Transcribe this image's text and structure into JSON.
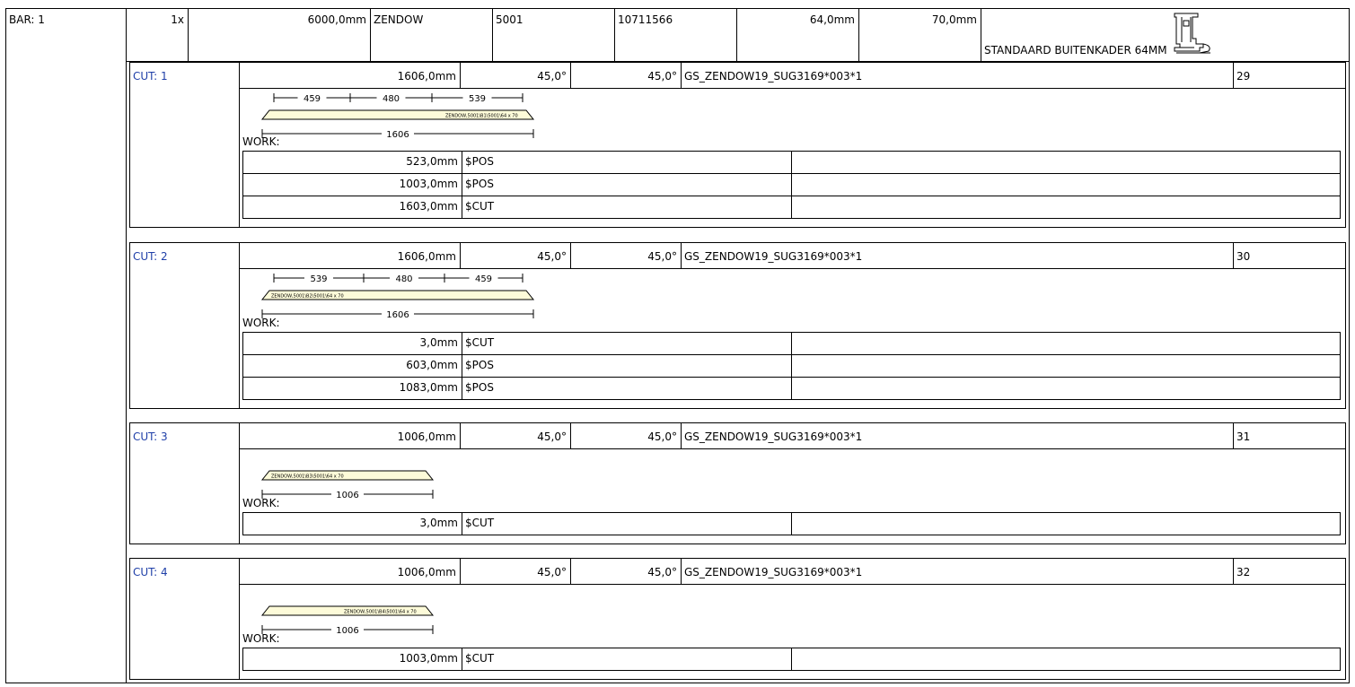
{
  "bar": {
    "label": "BAR: 1",
    "qty": "1x",
    "length": "6000,0mm",
    "brand": "ZENDOW",
    "color_code": "5001",
    "article": "10711566",
    "width": "64,0mm",
    "height": "70,0mm",
    "description": "STANDAARD BUITENKADER 64MM",
    "profile_icon": "profile-section-icon"
  },
  "cuts": [
    {
      "label": "CUT: 1",
      "length": "1606,0mm",
      "angle_left": "45,0°",
      "angle_right": "45,0°",
      "reference": "GS_ZENDOW19_SUG3169*003*1",
      "number": "29",
      "dims": [
        "459",
        "480",
        "539"
      ],
      "total": "1606",
      "bar_label": "ZENDOW,5001\\B1\\5001\\64 x 70",
      "work_label": "WORK:",
      "work": [
        {
          "pos": "523,0mm",
          "op": "$POS",
          "note": ""
        },
        {
          "pos": "1003,0mm",
          "op": "$POS",
          "note": ""
        },
        {
          "pos": "1603,0mm",
          "op": "$CUT",
          "note": ""
        }
      ]
    },
    {
      "label": "CUT: 2",
      "length": "1606,0mm",
      "angle_left": "45,0°",
      "angle_right": "45,0°",
      "reference": "GS_ZENDOW19_SUG3169*003*1",
      "number": "30",
      "dims": [
        "539",
        "480",
        "459"
      ],
      "total": "1606",
      "bar_label": "ZENDOW,5001\\B2\\5001\\64 x 70",
      "work_label": "WORK:",
      "work": [
        {
          "pos": "3,0mm",
          "op": "$CUT",
          "note": ""
        },
        {
          "pos": "603,0mm",
          "op": "$POS",
          "note": ""
        },
        {
          "pos": "1083,0mm",
          "op": "$POS",
          "note": ""
        }
      ]
    },
    {
      "label": "CUT: 3",
      "length": "1006,0mm",
      "angle_left": "45,0°",
      "angle_right": "45,0°",
      "reference": "GS_ZENDOW19_SUG3169*003*1",
      "number": "31",
      "dims": [],
      "total": "1006",
      "bar_label": "ZENDOW,5001\\B3\\5001\\64 x 70",
      "work_label": "WORK:",
      "work": [
        {
          "pos": "3,0mm",
          "op": "$CUT",
          "note": ""
        }
      ]
    },
    {
      "label": "CUT: 4",
      "length": "1006,0mm",
      "angle_left": "45,0°",
      "angle_right": "45,0°",
      "reference": "GS_ZENDOW19_SUG3169*003*1",
      "number": "32",
      "dims": [],
      "total": "1006",
      "bar_label": "ZENDOW,5001\\B4\\5001\\64 x 70",
      "work_label": "WORK:",
      "work": [
        {
          "pos": "1003,0mm",
          "op": "$CUT",
          "note": ""
        }
      ]
    }
  ],
  "colors": {
    "bar_fill": "#fdfbd9",
    "cut_label": "#1f3fa8"
  }
}
